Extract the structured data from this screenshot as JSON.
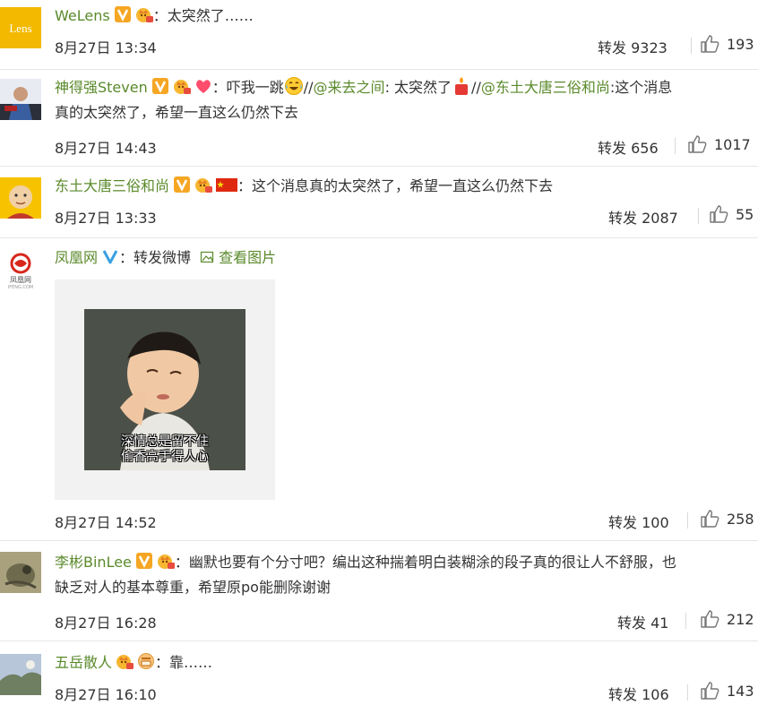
{
  "comments": [
    {
      "name": "WeLens",
      "colon": "：",
      "text": "太突然了……",
      "date": "8月27日 13:34",
      "repost": "转发 9323",
      "likes": "193",
      "avatar_text": "Lens"
    },
    {
      "name": "神得强Steven",
      "colon": "：",
      "text_a": "吓我一跳",
      "sl1": "//",
      "mention1": "@来去之间",
      "text_b": ": 太突然了",
      "sl2": "//",
      "mention2": "@东土大唐三俗和尚",
      "text_c": ":这个消息",
      "text_line2": "真的太突然了，希望一直这么仍然下去",
      "date": "8月27日 14:43",
      "repost": "转发 656",
      "likes": "1017"
    },
    {
      "name": "东土大唐三俗和尚",
      "colon": "：",
      "text": "这个消息真的太突然了，希望一直这么仍然下去",
      "date": "8月27日 13:33",
      "repost": "转发 2087",
      "likes": "55"
    },
    {
      "name": "凤凰网",
      "colon": "：",
      "text": "转发微博",
      "view_image": "查看图片",
      "image_caption_1": "深情总是留不住",
      "image_caption_2": "偷香高手得人心",
      "avatar_caption": "凤凰网",
      "avatar_sub": "IFENG.COM",
      "date": "8月27日 14:52",
      "repost": "转发 100",
      "likes": "258"
    },
    {
      "name": "李彬BinLee",
      "colon": "：",
      "text": "幽默也要有个分寸吧？编出这种揣着明白装糊涂的段子真的很让人不舒服，也",
      "text_line2": "缺乏对人的基本尊重，希望原po能删除谢谢",
      "date": "8月27日 16:28",
      "repost": "转发 41",
      "likes": "212"
    },
    {
      "name": "五岳散人",
      "colon": "：",
      "text": "靠……",
      "date": "8月27日 16:10",
      "repost": "转发 106",
      "likes": "143"
    }
  ],
  "colors": {
    "name": "#5a8a2b",
    "v_badge": "#f5a623",
    "v_blue": "#3aa0e3",
    "crown": "#f39c12",
    "heart": "#ff4d6d"
  },
  "icons": [
    "v-badge-icon",
    "crown-level-icon",
    "heart-icon",
    "laugh-cry-emoji",
    "candle-emoji",
    "china-flag-icon",
    "picture-icon",
    "like-thumb-icon"
  ]
}
